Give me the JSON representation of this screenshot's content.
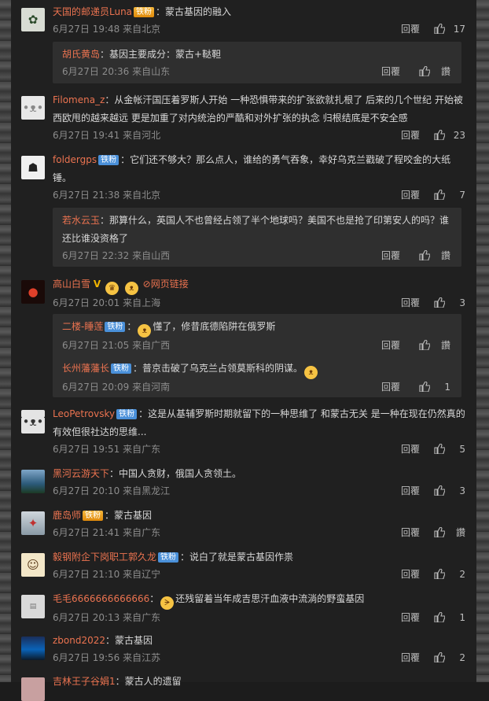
{
  "meta_labels": {
    "reply": "回覆",
    "like_word": "讚"
  },
  "colors": {
    "username": "#eb7350",
    "background": "#202020",
    "subbox": "#2f2f2f",
    "badge_tie": "#4a90d9"
  },
  "comments": [
    {
      "user": "天国的邮递员Luna",
      "badge": "铁粉",
      "text": "：蒙古基因的融入",
      "time": "6月27日 19:48 来自北京",
      "likes": "17"
    },
    {
      "user": "Filomena_z",
      "text": "：从金帐汗国压着罗斯人开始 一种恐惧带来的扩张欲就扎根了 后来的几个世纪 开始被西欧甩的越来越远 更是加重了对内统治的严酷和对外扩张的执念 归根结底是不安全感",
      "time": "6月27日 19:41 来自河北",
      "likes": "23"
    },
    {
      "user": "foldergps",
      "badge": "铁粉",
      "text": "：它们还不够大？那么点人，谁给的勇气吞象，幸好乌克兰戳破了程咬金的大纸锤。",
      "time": "6月27日 21:38 来自北京",
      "likes": "7"
    },
    {
      "user": "高山白雪",
      "link": "网页链接",
      "time": "6月27日 20:01 来自上海",
      "likes": "3"
    },
    {
      "user": "LeoPetrovsky",
      "badge": "铁粉",
      "text": "：这是从基辅罗斯时期就留下的一种思维了 和蒙古无关 是一种在现在仍然真的有效但很社达的思维...",
      "time": "6月27日 19:51 来自广东",
      "likes": "5"
    },
    {
      "user": "黑河云游天下",
      "text": "：中国人贪财，俄国人贪领土。",
      "time": "6月27日 20:10 来自黑龙江",
      "likes": "3"
    },
    {
      "user": "鹿岛师",
      "badge": "铁粉",
      "text": "：蒙古基因",
      "time": "6月27日 21:41 来自广东",
      "likes": "讚"
    },
    {
      "user": "毅钢附企下岗职工郭久龙",
      "badge": "铁粉",
      "text": "：说白了就是蒙古基因作祟",
      "time": "6月27日 21:10 来自辽宁",
      "likes": "2"
    },
    {
      "user": "毛毛6666666666666",
      "text": "还残留着当年成吉思汗血液中流淌的野蛮基因",
      "time": "6月27日 20:13 来自广东",
      "likes": "1"
    },
    {
      "user": "zbond2022",
      "text": "：蒙古基因",
      "time": "6月27日 19:56 来自江苏",
      "likes": "2"
    },
    {
      "user": "吉林王子谷娟1",
      "text": "：蒙古人的遗留"
    }
  ],
  "replies": [
    {
      "user": "胡氏黄岛",
      "text": "：基因主要成分：蒙古+鞑靼",
      "time": "6月27日 20:36 来自山东",
      "likes": "讚"
    },
    {
      "user": "若水云玉",
      "text": "：那算什么，英国人不也曾经占领了半个地球吗？美国不也是抢了印第安人的吗？谁还比谁没资格了",
      "time": "6月27日 22:32 来自山西",
      "likes": "讚"
    },
    {
      "user": "二楼-睡莲",
      "badge": "铁粉",
      "text": "懂了，修昔底德陷阱在俄罗斯",
      "time": "6月27日 21:05 来自广西",
      "likes": "讚"
    },
    {
      "user": "长州藩藩长",
      "badge": "铁粉",
      "text": "：普京击破了乌克兰占领莫斯科的阴谋。",
      "time": "6月27日 20:09 来自河南",
      "likes": "1"
    }
  ]
}
